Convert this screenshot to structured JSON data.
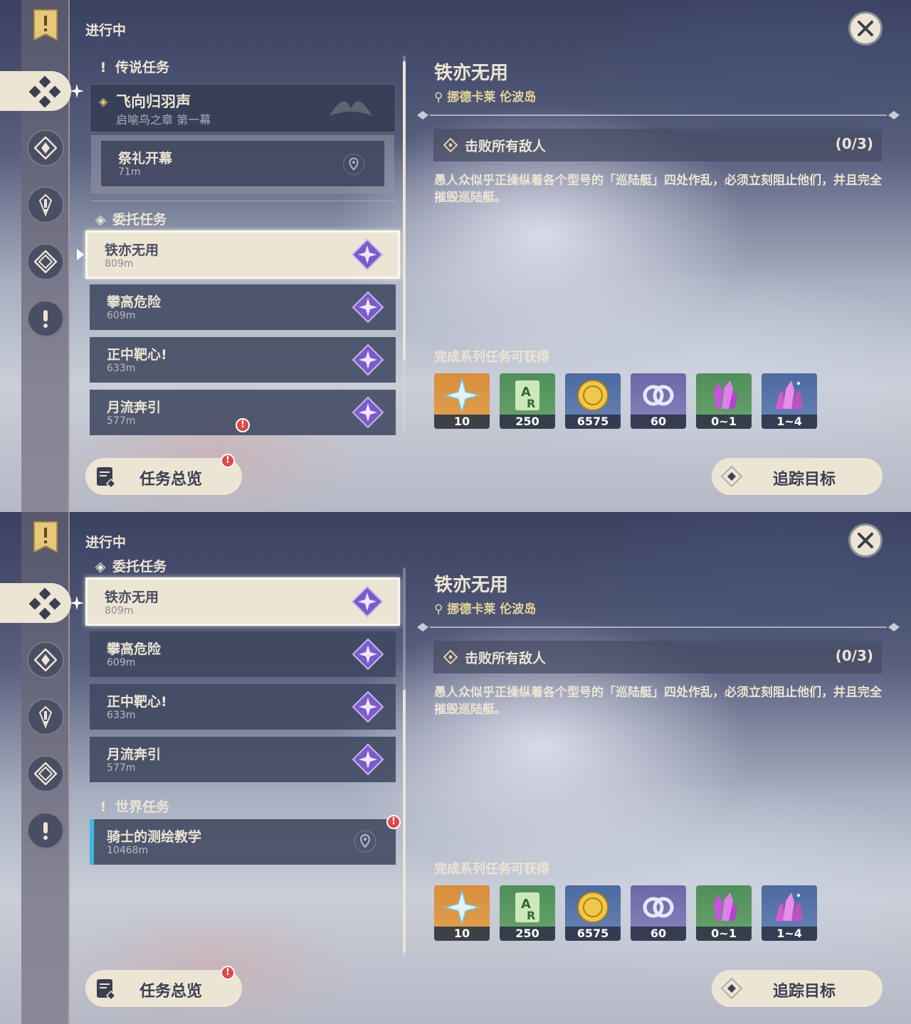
{
  "panels": [
    {
      "status_title": "进行中",
      "categories": {
        "legend": "传说任务",
        "commission": "委托任务",
        "world": "世界任务"
      },
      "legend_quest": {
        "name": "飞向归羽声",
        "subtitle": "启喻鸟之章 第一幕"
      },
      "legend_sub": {
        "name": "祭礼开幕",
        "distance": "71m"
      },
      "commissions": [
        {
          "name": "铁亦无用",
          "distance": "809m"
        },
        {
          "name": "攀高危险",
          "distance": "609m"
        },
        {
          "name": "正中靶心!",
          "distance": "633m"
        },
        {
          "name": "月流奔引",
          "distance": "577m"
        }
      ],
      "world_quest": {
        "name": "骑士的测绘教学",
        "distance": "10468m"
      }
    }
  ],
  "detail": {
    "title": "铁亦无用",
    "location": "挪德卡莱 伦波岛",
    "objective": "击败所有敌人",
    "progress": "(0/3)",
    "description": "愚人众似乎正操纵着各个型号的「巡陆艇」四处作乱，必须立刻阻止他们，并且完全摧毁巡陆艇。",
    "rewards_title": "完成系列任务可获得",
    "rewards": [
      {
        "icon": "primogem-icon",
        "amount": "10",
        "color": "#d98e3c"
      },
      {
        "icon": "adventure-exp-icon",
        "amount": "250",
        "color": "#4f8f5a"
      },
      {
        "icon": "mora-icon",
        "amount": "6575",
        "color": "#4c6aa0"
      },
      {
        "icon": "companionship-exp-icon",
        "amount": "60",
        "color": "#4c6aa0"
      },
      {
        "icon": "ore-crystal-icon",
        "amount": "0~1",
        "color": "#4f8f5a"
      },
      {
        "icon": "ore-crystal-cluster-icon",
        "amount": "1~4",
        "color": "#4c6aa0"
      }
    ]
  },
  "buttons": {
    "overview": "任务总览",
    "track": "追踪目标"
  }
}
